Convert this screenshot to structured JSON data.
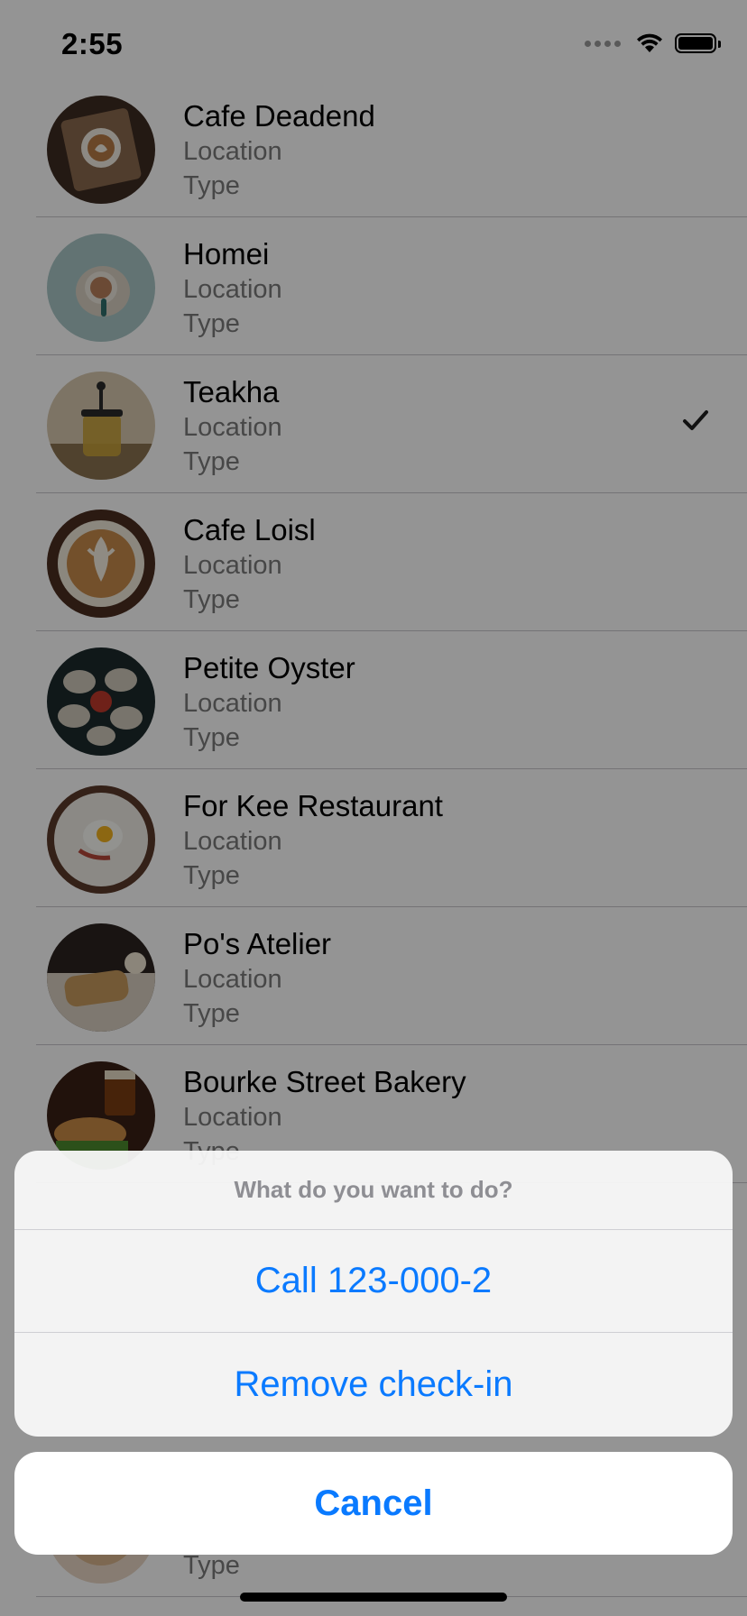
{
  "status_bar": {
    "time": "2:55"
  },
  "restaurants": [
    {
      "name": "Cafe Deadend",
      "location": "Location",
      "type": "Type",
      "checked": false
    },
    {
      "name": "Homei",
      "location": "Location",
      "type": "Type",
      "checked": false
    },
    {
      "name": "Teakha",
      "location": "Location",
      "type": "Type",
      "checked": true
    },
    {
      "name": "Cafe Loisl",
      "location": "Location",
      "type": "Type",
      "checked": false
    },
    {
      "name": "Petite Oyster",
      "location": "Location",
      "type": "Type",
      "checked": false
    },
    {
      "name": "For Kee Restaurant",
      "location": "Location",
      "type": "Type",
      "checked": false
    },
    {
      "name": "Po's Atelier",
      "location": "Location",
      "type": "Type",
      "checked": false
    },
    {
      "name": "Bourke Street Bakery",
      "location": "Location",
      "type": "Type",
      "checked": false
    },
    {
      "name": "",
      "location": "",
      "type": "Type",
      "checked": false
    }
  ],
  "action_sheet": {
    "title": "What do you want to do?",
    "call_label": "Call 123-000-2",
    "remove_label": "Remove check-in",
    "cancel_label": "Cancel"
  },
  "colors": {
    "accent": "#0a7aff",
    "dim_overlay": "rgba(0,0,0,0.42)",
    "separator": "#c8c7cc"
  },
  "icons": {
    "checkmark": "checkmark-icon",
    "wifi": "wifi-icon",
    "battery": "battery-icon",
    "signal": "signal-icon"
  }
}
